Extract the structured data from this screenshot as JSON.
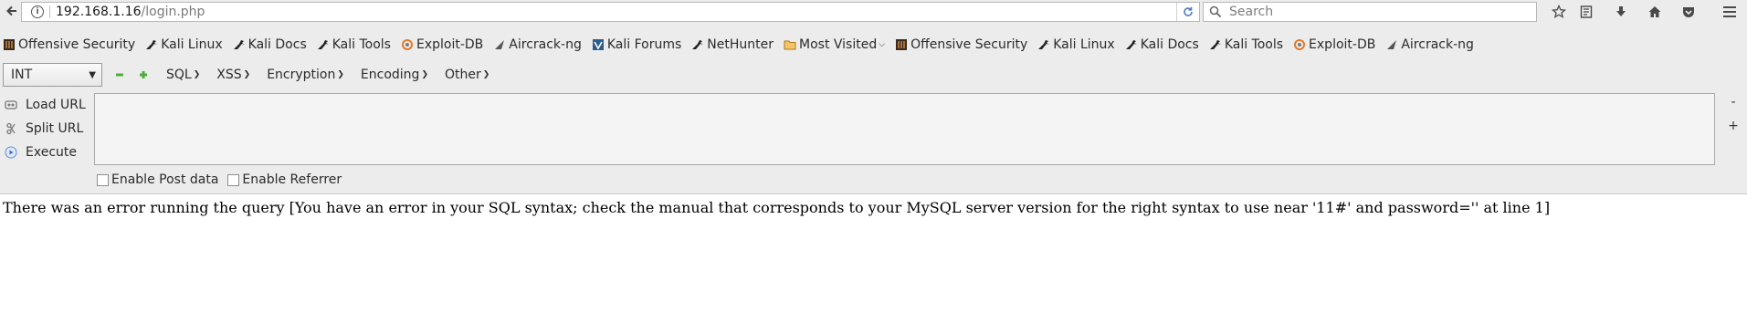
{
  "browser": {
    "url_host": "192.168.1.16",
    "url_path": "/login.php",
    "search_placeholder": "Search"
  },
  "bookmarks": [
    {
      "label": "Offensive Security",
      "icon": "offsec-icon"
    },
    {
      "label": "Kali Linux",
      "icon": "kali-dragon-icon"
    },
    {
      "label": "Kali Docs",
      "icon": "kali-dragon-icon"
    },
    {
      "label": "Kali Tools",
      "icon": "kali-dragon-icon"
    },
    {
      "label": "Exploit-DB",
      "icon": "exploitdb-icon"
    },
    {
      "label": "Aircrack-ng",
      "icon": "aircrack-icon"
    },
    {
      "label": "Kali Forums",
      "icon": "kali-forums-icon"
    },
    {
      "label": "NetHunter",
      "icon": "kali-dragon-icon"
    },
    {
      "label": "Most Visited",
      "icon": "folder-icon"
    },
    {
      "label": "Offensive Security",
      "icon": "offsec-icon"
    },
    {
      "label": "Kali Linux",
      "icon": "kali-dragon-icon"
    },
    {
      "label": "Kali Docs",
      "icon": "kali-dragon-icon"
    },
    {
      "label": "Kali Tools",
      "icon": "kali-dragon-icon"
    },
    {
      "label": "Exploit-DB",
      "icon": "exploitdb-icon"
    },
    {
      "label": "Aircrack-ng",
      "icon": "aircrack-icon"
    }
  ],
  "hackbar": {
    "select_value": "INT",
    "menus": [
      "SQL",
      "XSS",
      "Encryption",
      "Encoding",
      "Other"
    ],
    "actions": [
      {
        "label": "Load URL",
        "icon": "load-url-icon"
      },
      {
        "label": "Split URL",
        "icon": "split-url-icon"
      },
      {
        "label": "Execute",
        "icon": "execute-icon"
      }
    ],
    "textarea_value": "",
    "minus_label": "-",
    "plus_label": "+",
    "options": [
      "Enable Post data",
      "Enable Referrer"
    ]
  },
  "page": {
    "message": "There was an error running the query [You have an error in your SQL syntax; check the manual that corresponds to your MySQL server version for the right syntax to use near '11#' and password='' at line 1]"
  }
}
